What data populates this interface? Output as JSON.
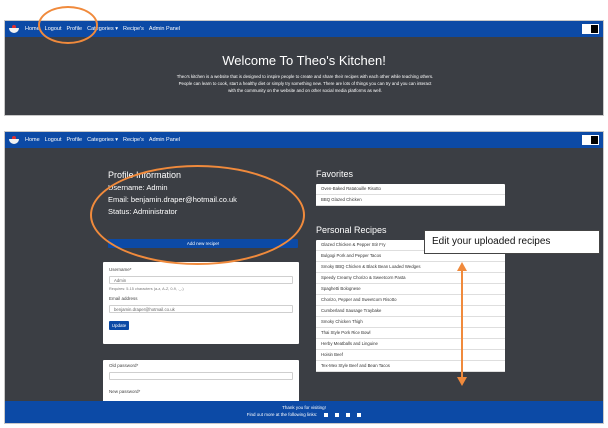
{
  "nav": {
    "links": [
      "Home",
      "Logout",
      "Profile",
      "Categories ▾",
      "Recipe's",
      "Admin Panel"
    ]
  },
  "hero": {
    "title": "Welcome To Theo's Kitchen!",
    "text": "Theo's kitchen is a website that is designed to inspire people to create and share their recipes with each other while teaching others. People can learn to cook, start a healthy diet or simply try something new. There are lots of things you can try and you can interact with the community on the website and on other social media platforms as well."
  },
  "profile": {
    "heading": "Profile Information",
    "username_line": "Username: Admin",
    "email_line": "Email: benjamin.draper@hotmail.co.uk",
    "status_line": "Status: Administrator",
    "add_recipe_label": "Add new recipe!"
  },
  "account_form": {
    "username_label": "Username*",
    "username_value": "Admin",
    "username_help": "Requires: 5-15 characters (a-z, A-Z, 0-9, ._-)",
    "email_label": "Email address",
    "email_value": "benjamin.draper@hotmail.co.uk",
    "update_label": "Update"
  },
  "password_form": {
    "old_label": "Old password*",
    "new_label": "New password*"
  },
  "favorites": {
    "title": "Favorites",
    "items": [
      "Oven-Baked Ratatouille Risotto",
      "BBQ Glazed Chicken"
    ]
  },
  "personal_recipes": {
    "title": "Personal Recipes",
    "items": [
      "Glazed Chicken & Pepper Stir Fry",
      "Bulgogi Pork and Pepper Tacos",
      "Smoky BBQ Chicken & Black Bean Loaded Wedges",
      "Speedy Creamy Chorizo & Sweetcorn Pasta",
      "Spaghetti Bolognese",
      "Chorizo, Pepper and Sweetcorn Risotto",
      "Cumberland Sausage Traybake",
      "Smoky Chicken Thigh",
      "Thai Style Pork Rice Bowl",
      "Herby Meatballs and Linguine",
      "Hoisin Beef",
      "Tex-Mex Style Beef and Bean Tacos"
    ]
  },
  "footer": {
    "thanks": "Thank you for visiting!",
    "follow": "Find out more at the following links:"
  },
  "annotation": {
    "callout_text": "Edit your uploaded recipes"
  },
  "colors": {
    "navbar": "#0c4aa6",
    "background": "#3b3e44",
    "annotation": "#f08a3c"
  }
}
